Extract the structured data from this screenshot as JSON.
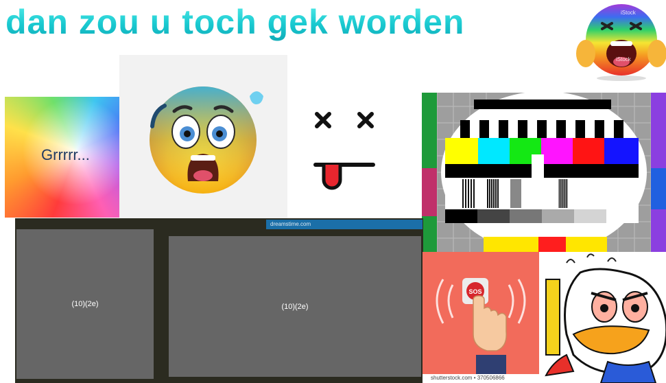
{
  "title": "dan zou u toch gek worden",
  "swirl_text": "Grrrrr...",
  "placeholders": [
    "(10)(2e)",
    "(10)(2e)"
  ],
  "sos_label": "SOS",
  "watermarks": {
    "dreamstime": "dreamstime.com",
    "istock_a": "iStock",
    "istock_b": "iStock",
    "shutterstock": "shutterstock.com • 370506866"
  },
  "colors": {
    "title": "#19c9d0",
    "placeholder": "#666666",
    "sos_bg": "#f26b5b",
    "tv_bars": [
      "#ffff00",
      "#00ffff",
      "#00ff00",
      "#ff00ff",
      "#ff0000",
      "#0000ff"
    ]
  }
}
